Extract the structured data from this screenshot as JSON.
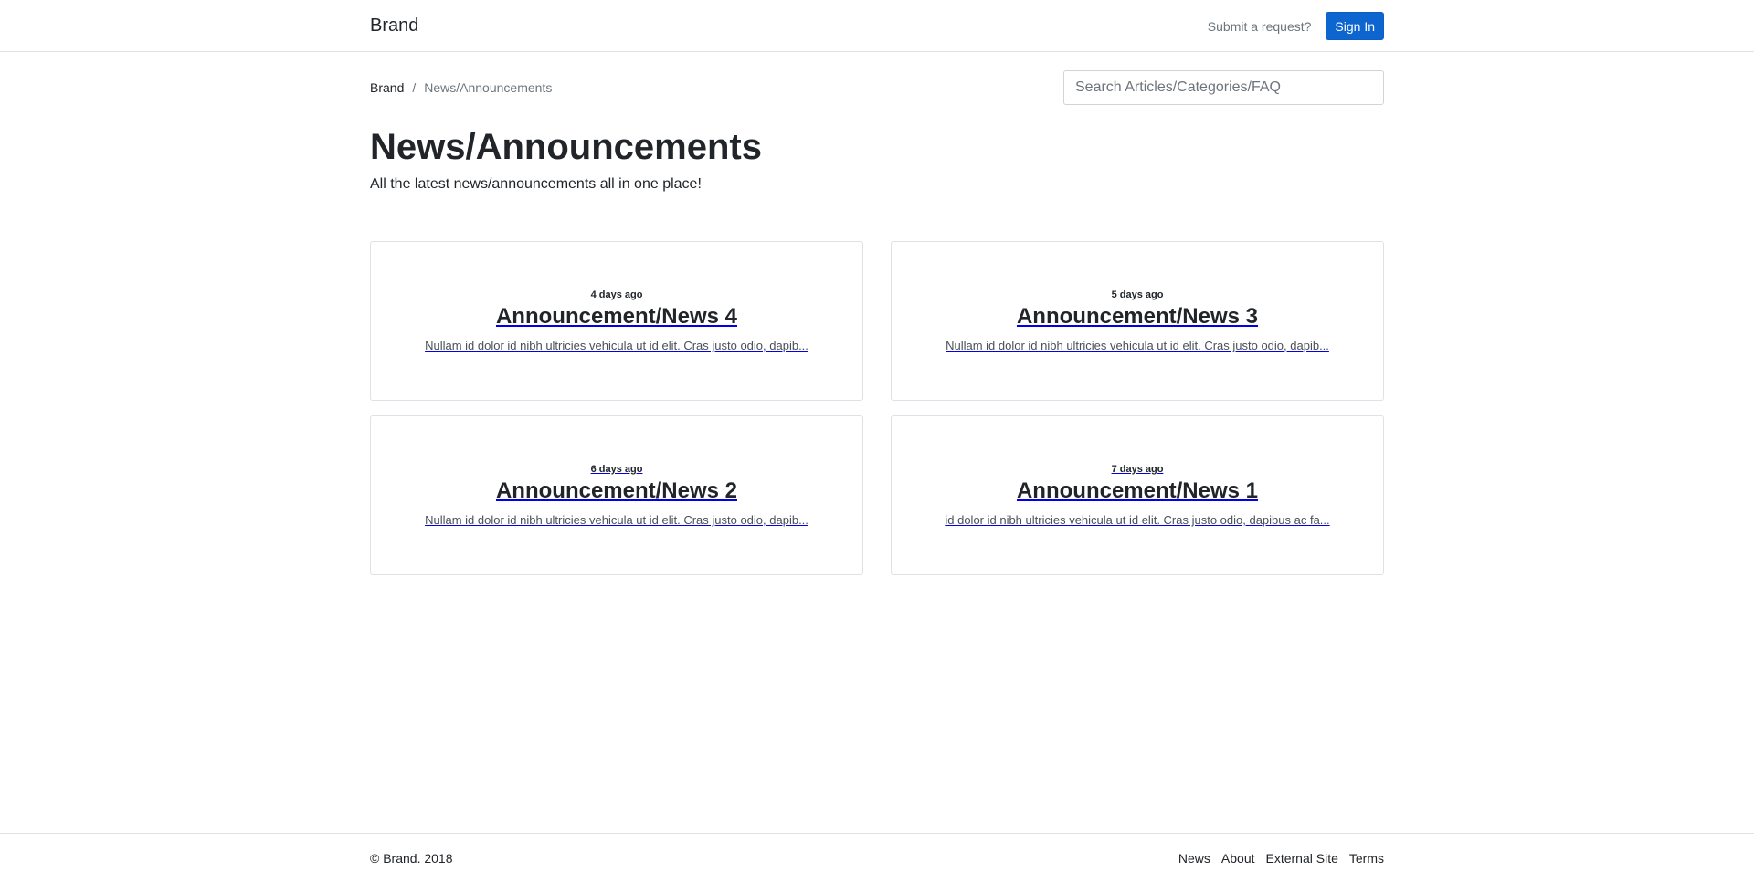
{
  "header": {
    "brand": "Brand",
    "submit_request": "Submit a request?",
    "sign_in": "Sign In"
  },
  "breadcrumb": {
    "home": "Brand",
    "separator": "/",
    "current": "News/Announcements"
  },
  "search": {
    "placeholder": "Search Articles/Categories/FAQ"
  },
  "page": {
    "title": "News/Announcements",
    "subtitle": "All the latest news/announcements all in one place!"
  },
  "cards": [
    {
      "time": "4 days ago",
      "title": "Announcement/News 4",
      "excerpt": "Nullam id dolor id nibh ultricies vehicula ut id elit. Cras justo odio, dapib..."
    },
    {
      "time": "5 days ago",
      "title": "Announcement/News 3",
      "excerpt": "Nullam id dolor id nibh ultricies vehicula ut id elit. Cras justo odio, dapib..."
    },
    {
      "time": "6 days ago",
      "title": "Announcement/News 2",
      "excerpt": "Nullam id dolor id nibh ultricies vehicula ut id elit. Cras justo odio, dapib..."
    },
    {
      "time": "7 days ago",
      "title": "Announcement/News 1",
      "excerpt": "id dolor id nibh ultricies vehicula ut id elit. Cras justo odio, dapibus ac fa..."
    }
  ],
  "footer": {
    "copyright": "© Brand. 2018",
    "links": [
      "News",
      "About",
      "External Site",
      "Terms"
    ]
  },
  "colors": {
    "primary": "#0d66d0",
    "border": "#dee2e6",
    "muted": "#6c757d",
    "text": "#212529"
  }
}
